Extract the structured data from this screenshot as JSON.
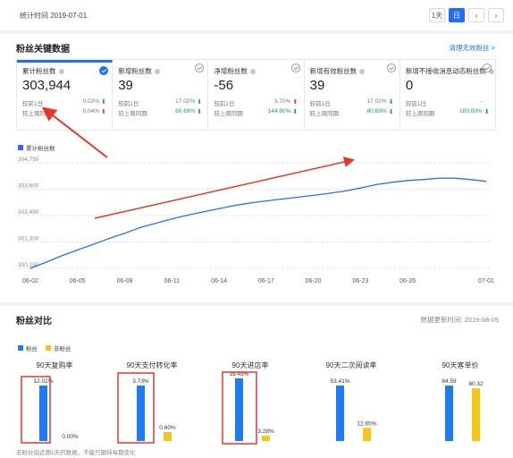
{
  "header": {
    "stat_time": "统计时间 2019-07-01",
    "btn_day": "1天",
    "btn_day2": "日",
    "btn_prev": "‹",
    "btn_next": "›"
  },
  "key_data": {
    "title": "粉丝关键数据",
    "link": "清理无效粉丝 >",
    "metrics": [
      {
        "label": "累计粉丝数",
        "value": "303,944",
        "r1k": "较前1日",
        "r1v": "0.02%",
        "r1dir": "down",
        "r2k": "较上周同期",
        "r2v": "0.04%",
        "r2dir": "up",
        "active": true
      },
      {
        "label": "新增粉丝数",
        "value": "39",
        "r1k": "较前1日",
        "r1v": "17.02%",
        "r1dir": "down",
        "r2k": "较上周同期",
        "r2v": "80.69%",
        "r2dir": "down",
        "active": false
      },
      {
        "label": "净增粉丝数",
        "value": "-56",
        "r1k": "较前1日",
        "r1v": "3.70%",
        "r1dir": "up",
        "r2k": "较上周同期",
        "r2v": "144.80%",
        "r2dir": "down",
        "active": false
      },
      {
        "label": "新增有效粉丝数",
        "value": "39",
        "r1k": "较前1日",
        "r1v": "17.02%",
        "r1dir": "down",
        "r2k": "较上周同期",
        "r2v": "80.69%",
        "r2dir": "down",
        "active": false
      },
      {
        "label": "新增不接收消息动态粉丝数",
        "value": "0",
        "r1k": "较前1日",
        "r1v": "-",
        "r1dir": "",
        "r2k": "较上周同期",
        "r2v": "100.00%",
        "r2dir": "down",
        "active": false
      }
    ]
  },
  "chart_data": [
    {
      "type": "line",
      "legend": [
        "累计粉丝数"
      ],
      "x": [
        "06-02",
        "06-03",
        "06-04",
        "06-05",
        "06-06",
        "06-07",
        "06-08",
        "06-09",
        "06-10",
        "06-11",
        "06-12",
        "06-13",
        "06-14",
        "06-15",
        "06-16",
        "06-17",
        "06-18",
        "06-19",
        "06-20",
        "06-21",
        "06-22",
        "06-23",
        "06-24",
        "06-25",
        "06-26",
        "06-27",
        "06-28",
        "06-29",
        "06-30",
        "07-01"
      ],
      "x_ticks": [
        "06-02",
        "06-05",
        "06-08",
        "06-11",
        "06-14",
        "06-17",
        "06-20",
        "06-23",
        "06-26",
        "07-01"
      ],
      "y_ticks": [
        "304,750",
        "303,600",
        "302,450",
        "301,300",
        "300,150"
      ],
      "ylim": [
        300150,
        304750
      ],
      "series": [
        {
          "name": "累计粉丝数",
          "color": "#2f6bff",
          "values": [
            300150,
            300420,
            300700,
            300950,
            301200,
            301450,
            301680,
            301930,
            302120,
            302300,
            302470,
            302610,
            302750,
            302890,
            303000,
            303090,
            303170,
            303250,
            303330,
            303420,
            303520,
            303650,
            303800,
            303900,
            303980,
            304020,
            304080,
            304080,
            304020,
            303944
          ]
        }
      ]
    },
    {
      "type": "bar",
      "title": "粉丝对比",
      "legend": [
        "粉丝",
        "非粉丝"
      ],
      "categories": [
        "90天复购率",
        "90天支付转化率",
        "90天进店率",
        "90天二次阅读率",
        "90天客单价"
      ],
      "series": [
        {
          "name": "粉丝",
          "color": "#1e7bf5",
          "values": [
            12.02,
            3.73,
            39.45,
            53.41,
            84.59
          ],
          "labels": [
            "12.02%",
            "3.73%",
            "39.45%",
            "53.41%",
            "84.59"
          ]
        },
        {
          "name": "非粉丝",
          "color": "#f5c518",
          "values": [
            0.0,
            0.6,
            3.28,
            12.65,
            80.32
          ],
          "labels": [
            "0.00%",
            "0.60%",
            "3.28%",
            "12.65%",
            "80.32"
          ]
        }
      ]
    }
  ],
  "compare": {
    "title": "粉丝对比",
    "update_time": "数据更新时间: 2019-08-05"
  },
  "footnote": "非粉丝指近期1天的数据，不能只期待每期变化",
  "colors": {
    "accent": "#1e6fff",
    "annotation": "#e8352b",
    "fan": "#1e7bf5",
    "nonfan": "#f5c518"
  }
}
